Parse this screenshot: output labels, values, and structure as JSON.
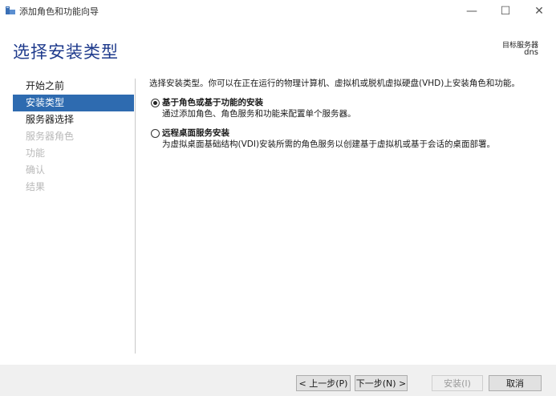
{
  "window": {
    "title": "添加角色和功能向导",
    "minimize_symbol": "—",
    "maximize_symbol": "☐",
    "close_symbol": "✕"
  },
  "header": {
    "page_title": "选择安装类型",
    "target_server_label": "目标服务器",
    "target_server_name": "dns"
  },
  "sidebar": {
    "items": [
      {
        "label": "开始之前",
        "state": "normal"
      },
      {
        "label": "安装类型",
        "state": "active"
      },
      {
        "label": "服务器选择",
        "state": "normal"
      },
      {
        "label": "服务器角色",
        "state": "disabled"
      },
      {
        "label": "功能",
        "state": "disabled"
      },
      {
        "label": "确认",
        "state": "disabled"
      },
      {
        "label": "结果",
        "state": "disabled"
      }
    ]
  },
  "main": {
    "description": "选择安装类型。你可以在正在运行的物理计算机、虚拟机或脱机虚拟硬盘(VHD)上安装角色和功能。",
    "options": [
      {
        "title": "基于角色或基于功能的安装",
        "description": "通过添加角色、角色服务和功能来配置单个服务器。",
        "selected": true
      },
      {
        "title": "远程桌面服务安装",
        "description": "为虚拟桌面基础结构(VDI)安装所需的角色服务以创建基于虚拟机或基于会话的桌面部署。",
        "selected": false
      }
    ]
  },
  "footer": {
    "prev_label": "< 上一步(P)",
    "next_label": "下一步(N) >",
    "install_label": "安装(I)",
    "cancel_label": "取消"
  },
  "colors": {
    "accent": "#2e6bb0",
    "title_blue": "#1e3a8c",
    "disabled_text": "#b9b9b9"
  }
}
